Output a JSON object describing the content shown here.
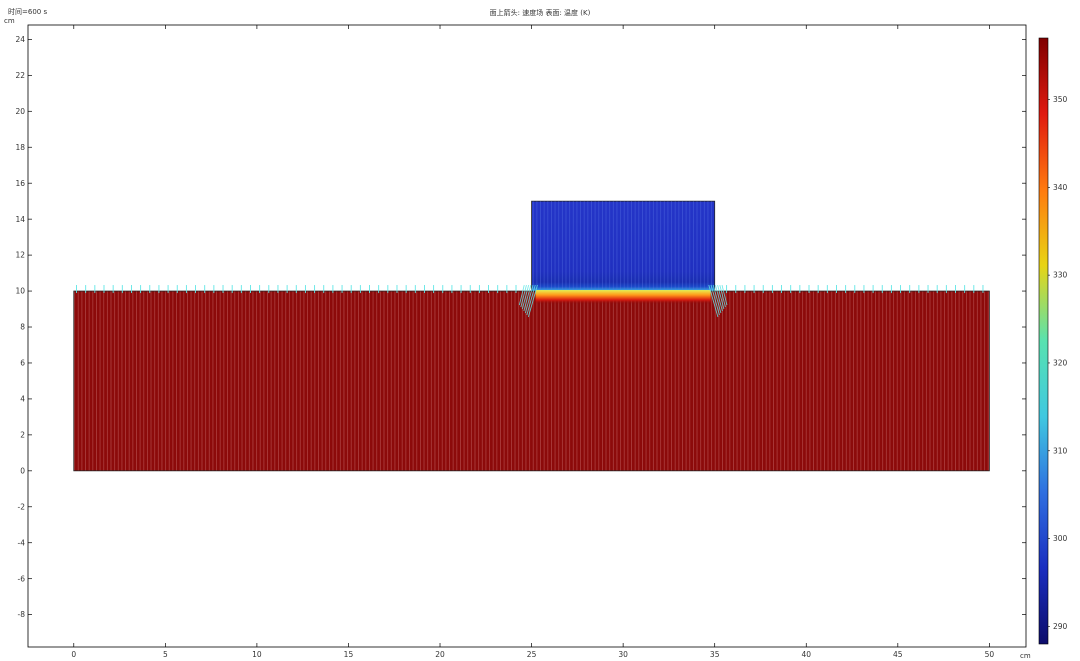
{
  "header": {
    "time_label": "时间=600 s",
    "title": "面上箭头: 速度场  表面: 温度 (K)"
  },
  "colors": {
    "hot_block": "#8c0a0a",
    "cold_block": "#2435c8",
    "arrow_cyan": "#5fe6e6",
    "interface_glow": "#ff7a1a"
  },
  "chart_data": {
    "type": "heatmap",
    "title": "面上箭头: 速度场  表面: 温度 (K)",
    "annotation": "时间=600 s",
    "x_unit": "cm",
    "y_unit": "cm",
    "xlim": [
      -2.5,
      52
    ],
    "ylim": [
      -9.8,
      24.8
    ],
    "x_ticks": [
      0,
      5,
      10,
      15,
      20,
      25,
      30,
      35,
      40,
      45,
      50
    ],
    "y_ticks": [
      -8,
      -6,
      -4,
      -2,
      0,
      2,
      4,
      6,
      8,
      10,
      12,
      14,
      16,
      18,
      20,
      22,
      24
    ],
    "regions": [
      {
        "name": "hot",
        "x": [
          0,
          50
        ],
        "y": [
          0,
          10
        ],
        "temperature_K": 356
      },
      {
        "name": "cold",
        "x": [
          25,
          35
        ],
        "y": [
          10,
          15
        ],
        "temperature_K": 298
      }
    ],
    "colorbar": {
      "range": [
        288,
        357
      ],
      "ticks": [
        290,
        300,
        310,
        320,
        330,
        340,
        350
      ],
      "stops": [
        "#0d0d6b",
        "#1a2ec0",
        "#2f6fe0",
        "#3fc8e0",
        "#58e2b0",
        "#e8d414",
        "#ff7a10",
        "#e01a10",
        "#800000"
      ]
    }
  }
}
